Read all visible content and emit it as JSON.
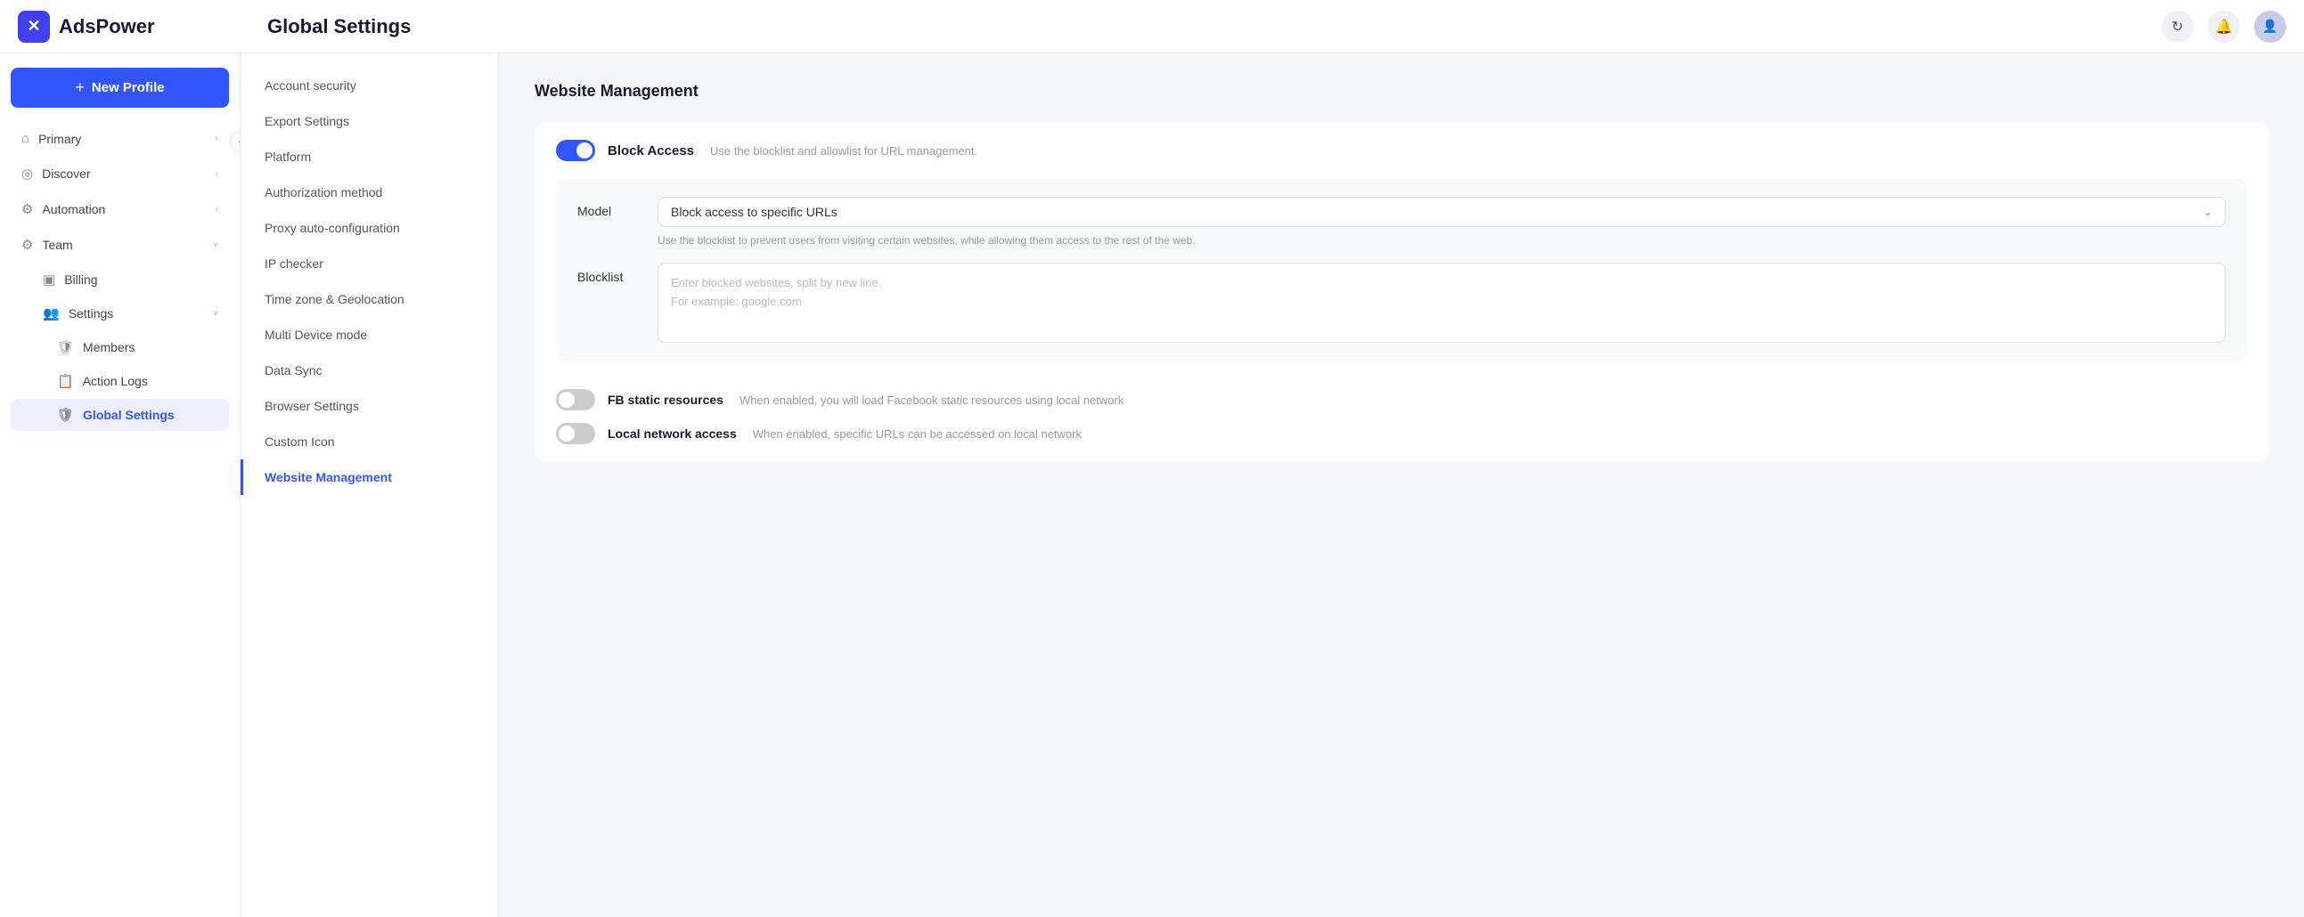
{
  "header": {
    "logo_text": "AdsPower",
    "page_title": "Global Settings",
    "refresh_icon": "↻",
    "bell_icon": "🔔",
    "avatar_icon": "👤"
  },
  "sidebar": {
    "new_profile_label": "New Profile",
    "collapse_icon": "‹",
    "nav_items": [
      {
        "id": "primary",
        "label": "Primary",
        "icon": "⌂",
        "has_chevron": true
      },
      {
        "id": "discover",
        "label": "Discover",
        "icon": "◎",
        "has_chevron": true
      },
      {
        "id": "automation",
        "label": "Automation",
        "icon": "⚙",
        "has_chevron": true
      },
      {
        "id": "team",
        "label": "Team",
        "icon": "⚙",
        "has_chevron": true
      }
    ],
    "sub_items": [
      {
        "id": "billing",
        "label": "Billing",
        "icon": "▣"
      },
      {
        "id": "settings",
        "label": "Settings",
        "icon": "👥",
        "has_chevron": true
      },
      {
        "id": "members",
        "label": "Members",
        "icon": "🛡"
      },
      {
        "id": "action-logs",
        "label": "Action Logs",
        "icon": "📋"
      },
      {
        "id": "global-settings",
        "label": "Global Settings",
        "icon": "🛡",
        "active": true
      }
    ]
  },
  "settings_nav": {
    "items": [
      {
        "id": "account-security",
        "label": "Account security",
        "active": false
      },
      {
        "id": "export-settings",
        "label": "Export Settings",
        "active": false
      },
      {
        "id": "platform",
        "label": "Platform",
        "active": false
      },
      {
        "id": "authorization-method",
        "label": "Authorization method",
        "active": false
      },
      {
        "id": "proxy-auto-configuration",
        "label": "Proxy auto-configuration",
        "active": false
      },
      {
        "id": "ip-checker",
        "label": "IP checker",
        "active": false
      },
      {
        "id": "time-zone-geolocation",
        "label": "Time zone & Geolocation",
        "active": false
      },
      {
        "id": "multi-device-mode",
        "label": "Multi Device mode",
        "active": false
      },
      {
        "id": "data-sync",
        "label": "Data Sync",
        "active": false
      },
      {
        "id": "browser-settings",
        "label": "Browser Settings",
        "active": false
      },
      {
        "id": "custom-icon",
        "label": "Custom Icon",
        "active": false
      },
      {
        "id": "website-management",
        "label": "Website Management",
        "active": true
      }
    ]
  },
  "content": {
    "section_title": "Website Management",
    "block_access": {
      "label": "Block Access",
      "description": "Use the blocklist and allowlist for URL management.",
      "enabled": true
    },
    "model": {
      "label": "Model",
      "value": "Block access to specific URLs",
      "description": "Use the blocklist to prevent users from visiting certain websites, while allowing them access to the rest of the web."
    },
    "blocklist": {
      "label": "Blocklist",
      "placeholder_line1": "Enter blocked websites, split by new line.",
      "placeholder_line2": "For example: google.com"
    },
    "fb_static": {
      "label": "FB static resources",
      "description": "When enabled, you will load Facebook static resources using local network",
      "enabled": false
    },
    "local_network": {
      "label": "Local network access",
      "description": "When enabled, specific URLs can be accessed on local network",
      "enabled": false
    }
  }
}
